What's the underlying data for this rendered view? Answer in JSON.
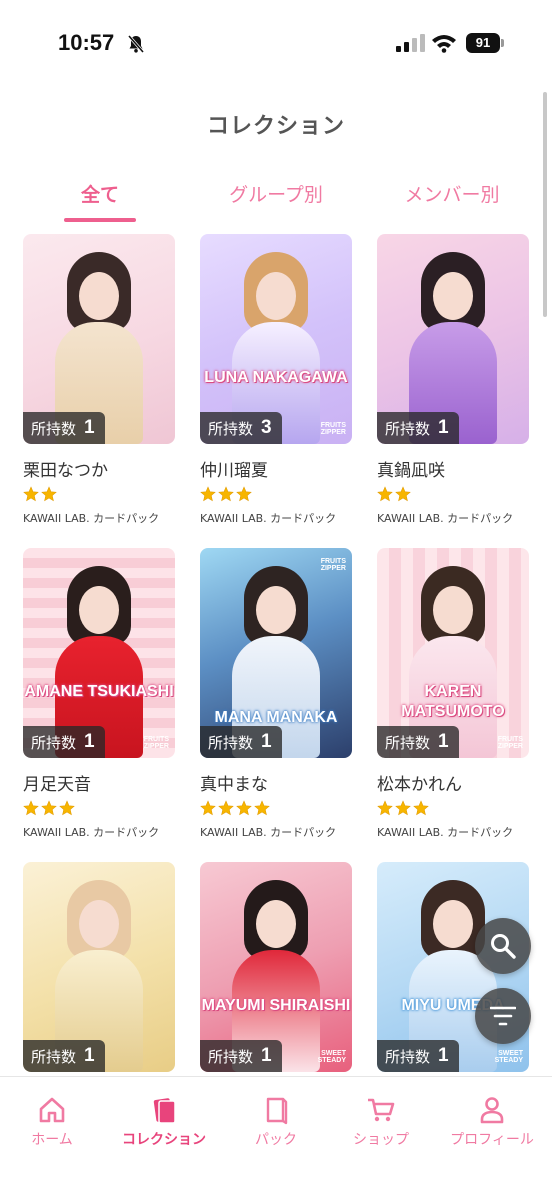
{
  "status": {
    "time": "10:57",
    "battery": "91"
  },
  "header": {
    "title": "コレクション"
  },
  "tabs": [
    {
      "label": "全て",
      "active": true
    },
    {
      "label": "グループ別",
      "active": false
    },
    {
      "label": "メンバー別",
      "active": false
    }
  ],
  "count_label": "所持数",
  "cards": [
    {
      "member": "栗田なつか",
      "stars": 2,
      "pack": "KAWAII LAB. カードパック",
      "count": "1",
      "art_text": ""
    },
    {
      "member": "仲川瑠夏",
      "stars": 3,
      "pack": "KAWAII LAB. カードパック",
      "count": "3",
      "art_text": "LUNA NAKAGAWA"
    },
    {
      "member": "真鍋凪咲",
      "stars": 2,
      "pack": "KAWAII LAB. カードパック",
      "count": "1",
      "art_text": ""
    },
    {
      "member": "月足天音",
      "stars": 3,
      "pack": "KAWAII LAB. カードパック",
      "count": "1",
      "art_text": "AMANE TSUKIASHI"
    },
    {
      "member": "真中まな",
      "stars": 4,
      "pack": "KAWAII LAB. カードパック",
      "count": "1",
      "art_text": "MANA MANAKA"
    },
    {
      "member": "松本かれん",
      "stars": 3,
      "pack": "KAWAII LAB. カードパック",
      "count": "1",
      "art_text": "KAREN MATSUMOTO"
    },
    {
      "member": "",
      "stars": 0,
      "pack": "",
      "count": "1",
      "art_text": ""
    },
    {
      "member": "",
      "stars": 0,
      "pack": "",
      "count": "1",
      "art_text": "MAYUMI SHIRAISHI"
    },
    {
      "member": "",
      "stars": 0,
      "pack": "",
      "count": "1",
      "art_text": "MIYU UMEDA"
    }
  ],
  "fabs": {
    "search": "search-icon",
    "filter": "filter-icon"
  },
  "nav": [
    {
      "label": "ホーム",
      "icon": "home-icon",
      "active": false
    },
    {
      "label": "コレクション",
      "icon": "collection-icon",
      "active": true
    },
    {
      "label": "パック",
      "icon": "pack-icon",
      "active": false
    },
    {
      "label": "ショップ",
      "icon": "cart-icon",
      "active": false
    },
    {
      "label": "プロフィール",
      "icon": "person-icon",
      "active": false
    }
  ],
  "colors": {
    "accent": "#ee5f8e",
    "star": "#f7b500"
  }
}
